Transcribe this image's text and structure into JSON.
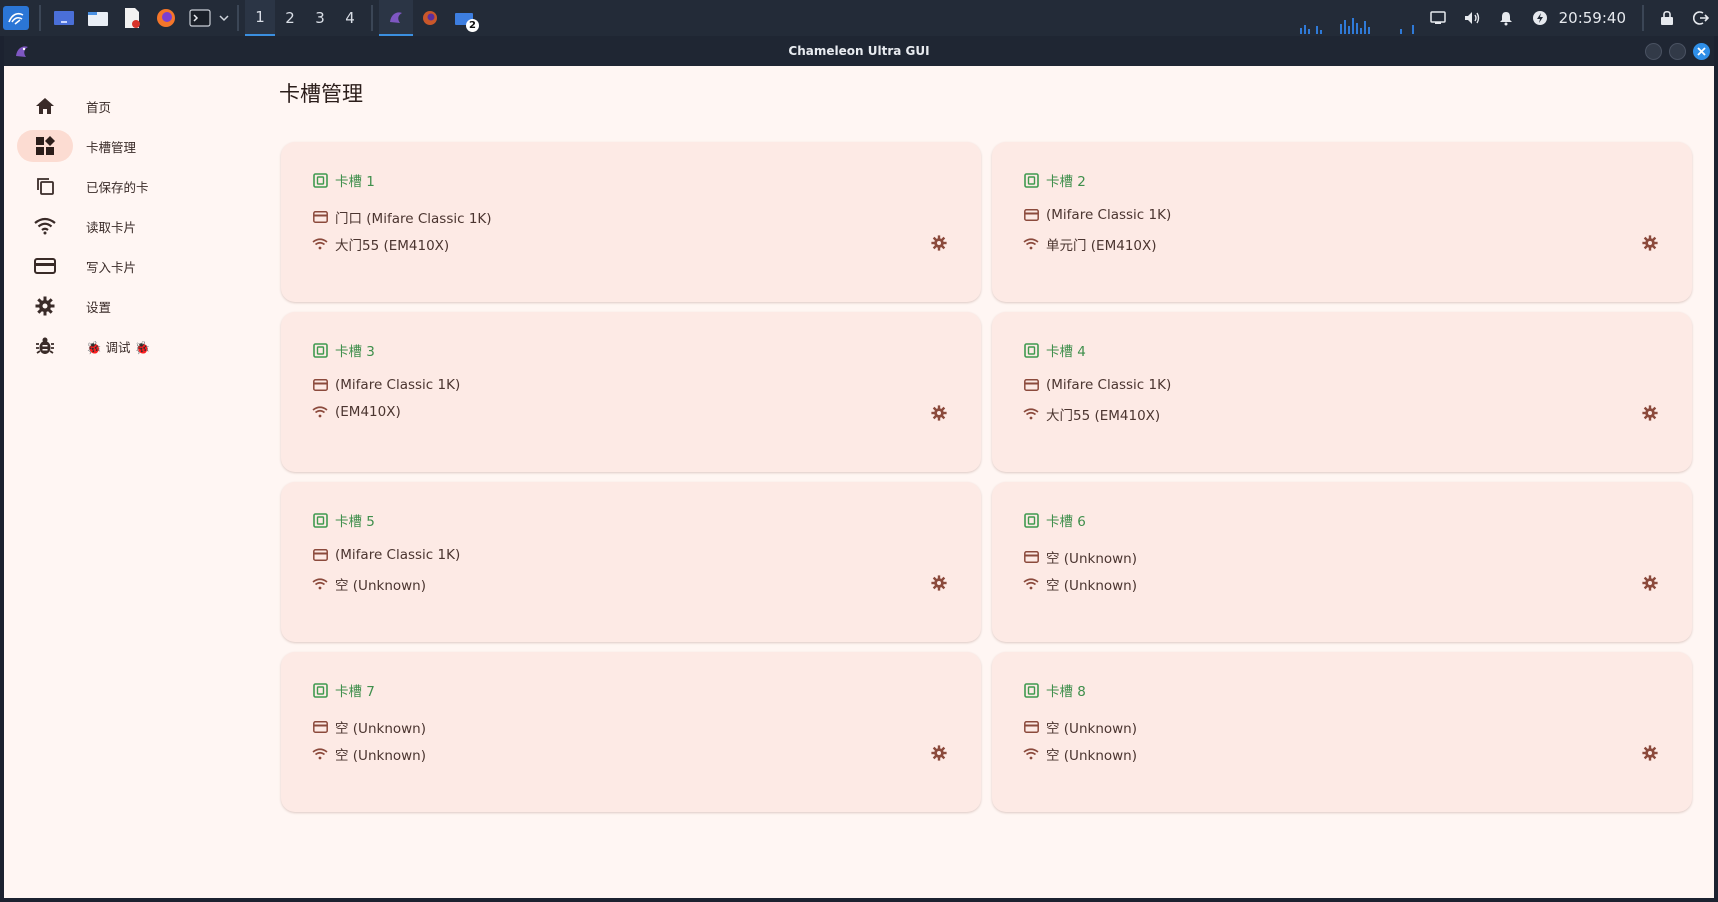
{
  "taskbar": {
    "workspaces": [
      "1",
      "2",
      "3",
      "4"
    ],
    "active_workspace": "1",
    "badge_count": "2",
    "clock": "20:59:40"
  },
  "window": {
    "title": "Chameleon Ultra GUI"
  },
  "sidebar": {
    "items": [
      {
        "label": "首页",
        "icon": "home-icon"
      },
      {
        "label": "卡槽管理",
        "icon": "dashboard-icon",
        "active": true
      },
      {
        "label": "已保存的卡",
        "icon": "copy-icon"
      },
      {
        "label": "读取卡片",
        "icon": "wifi-icon"
      },
      {
        "label": "写入卡片",
        "icon": "credit-card-icon"
      },
      {
        "label": "设置",
        "icon": "gear-icon"
      },
      {
        "label": "🐞 调试 🐞",
        "icon": "bug-icon"
      }
    ]
  },
  "main": {
    "title": "卡槽管理",
    "slots": [
      {
        "name": "卡槽 1",
        "hf": "门口 (Mifare Classic 1K)",
        "lf": "大门55 (EM410X)"
      },
      {
        "name": "卡槽 2",
        "hf": "(Mifare Classic 1K)",
        "lf": "单元门 (EM410X)"
      },
      {
        "name": "卡槽 3",
        "hf": "(Mifare Classic 1K)",
        "lf": "(EM410X)"
      },
      {
        "name": "卡槽 4",
        "hf": "(Mifare Classic 1K)",
        "lf": "大门55 (EM410X)"
      },
      {
        "name": "卡槽 5",
        "hf": "(Mifare Classic 1K)",
        "lf": "空 (Unknown)"
      },
      {
        "name": "卡槽 6",
        "hf": "空 (Unknown)",
        "lf": "空 (Unknown)"
      },
      {
        "name": "卡槽 7",
        "hf": "空 (Unknown)",
        "lf": "空 (Unknown)"
      },
      {
        "name": "卡槽 8",
        "hf": "空 (Unknown)",
        "lf": "空 (Unknown)"
      }
    ]
  },
  "colors": {
    "accent": "#8b4a3c",
    "slot_icon": "#3f9a4f",
    "card_bg": "#fdeae5",
    "page_bg": "#fff6f3",
    "active_pill": "#fcdcd2"
  }
}
